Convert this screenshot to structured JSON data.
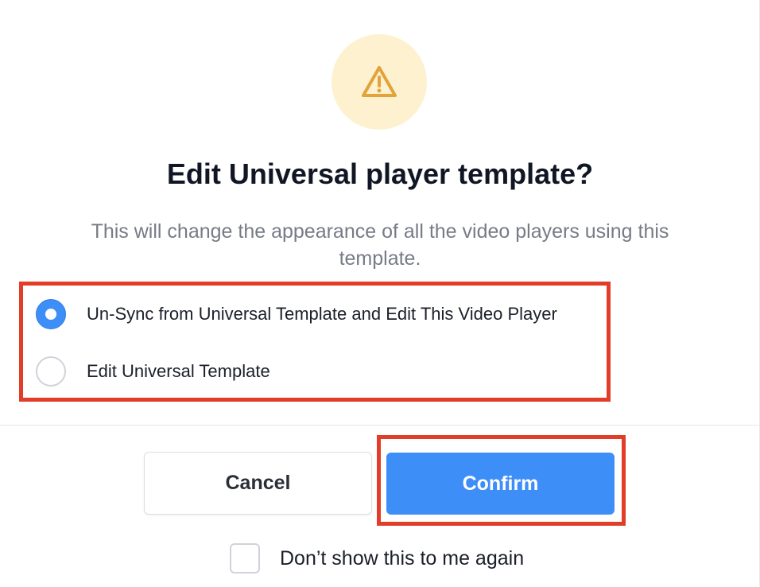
{
  "dialog": {
    "icon": "warning-icon",
    "title": "Edit Universal player template?",
    "description": "This will change the appearance of all the video players using this template.",
    "options": [
      {
        "label": "Un-Sync from Universal Template and Edit This Video Player",
        "selected": true
      },
      {
        "label": "Edit Universal Template",
        "selected": false
      }
    ],
    "cancel_label": "Cancel",
    "confirm_label": "Confirm",
    "dont_show_label": "Don’t show this to me again",
    "dont_show_checked": false
  },
  "colors": {
    "accent": "#3e8ef7",
    "warning_bg": "#fdf1cf",
    "warning_icon": "#e2a33c",
    "highlight": "#e23d28"
  }
}
